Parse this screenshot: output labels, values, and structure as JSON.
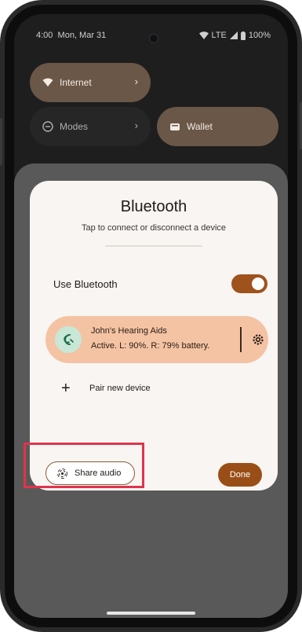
{
  "status_bar": {
    "time": "4:00",
    "date": "Mon, Mar 31",
    "network": "LTE",
    "battery": "100%",
    "icons": [
      "wifi-icon",
      "signal-icon",
      "battery-icon"
    ]
  },
  "quick_settings": {
    "tiles": [
      {
        "label": "Internet",
        "icon": "wifi-icon",
        "active": true
      },
      {
        "label": "Modes",
        "icon": "modes-icon",
        "active": false
      },
      {
        "label": "Wallet",
        "icon": "wallet-icon",
        "active": true
      }
    ]
  },
  "dialog": {
    "title": "Bluetooth",
    "subtitle": "Tap to connect or disconnect a device",
    "use_bluetooth_label": "Use Bluetooth",
    "use_bluetooth_on": true,
    "device": {
      "name": "John's Hearing Aids",
      "status": "Active. L: 90%. R: 79% battery.",
      "icon": "hearing-aid-icon"
    },
    "pair_new_label": "Pair new device",
    "share_audio_label": "Share audio",
    "done_label": "Done"
  },
  "colors": {
    "accent": "#9a4e17",
    "device_card": "#f4c3a4",
    "tile_active": "#6a5748",
    "highlight": "#e0344d"
  }
}
